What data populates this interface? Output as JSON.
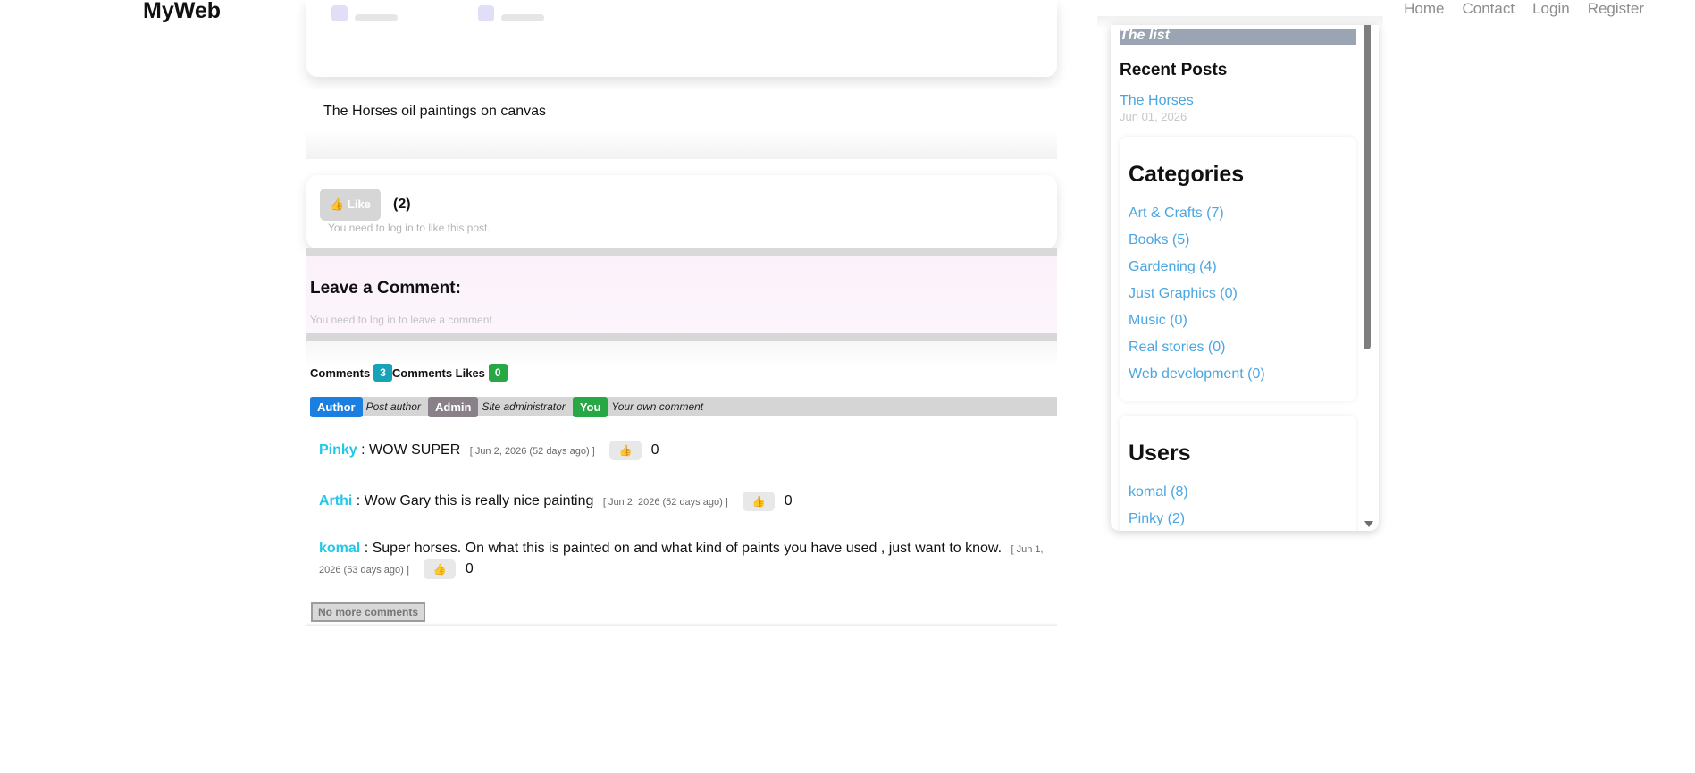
{
  "header": {
    "brand": "MyWeb",
    "nav": [
      "Home",
      "Contact",
      "Login",
      "Register"
    ]
  },
  "post": {
    "description": "The Horses oil paintings on canvas",
    "like_label": "👍 Like",
    "like_count": "(2)",
    "like_note": "You need to log in to like this post."
  },
  "comment_form": {
    "title": "Leave a Comment:",
    "note": "You need to log in to leave a comment."
  },
  "comments": {
    "comments_label": "Comments",
    "comments_count": "3",
    "likes_label": "Comments Likes",
    "likes_count": "0",
    "legend": {
      "author_tag": "Author",
      "author_desc": "Post author",
      "admin_tag": "Admin",
      "admin_desc": "Site administrator",
      "you_tag": "You",
      "you_desc": "Your own comment"
    },
    "items": [
      {
        "user": "Pinky",
        "text": ": WOW SUPER",
        "date": "[ Jun 2, 2026 (52 days ago) ]",
        "likes": "0"
      },
      {
        "user": "Arthi",
        "text": ": Wow Gary this is really nice painting",
        "date": "[ Jun 2, 2026 (52 days ago) ]",
        "likes": "0"
      },
      {
        "user": "komal",
        "text": ": Super horses. On what this is painted on and what kind of paints you have used , just want to know.",
        "date": "[ Jun 1, 2026 (53 days ago) ]",
        "likes": "0"
      }
    ],
    "no_more": "No more comments"
  },
  "sidebar": {
    "list_title": "The list",
    "recent_title": "Recent Posts",
    "recent_post": "The Horses",
    "recent_date": "Jun 01, 2026",
    "categories_title": "Categories",
    "categories": [
      "Art & Crafts (7)",
      "Books (5)",
      "Gardening (4)",
      "Just Graphics (0)",
      "Music (0)",
      "Real stories (0)",
      "Web development (0)"
    ],
    "users_title": "Users",
    "users": [
      "komal (8)",
      "Pinky (2)"
    ]
  },
  "colors": {
    "link": "#4aa6e0",
    "username": "#22c8e8",
    "author": "#1a7fe0",
    "admin": "#8a8089",
    "you": "#28a745",
    "teal_badge": "#17a2b8"
  }
}
